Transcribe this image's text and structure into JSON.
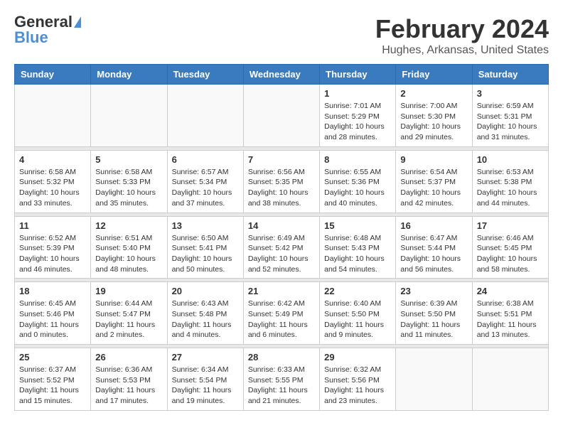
{
  "header": {
    "logo_general": "General",
    "logo_blue": "Blue",
    "month": "February 2024",
    "location": "Hughes, Arkansas, United States"
  },
  "weekdays": [
    "Sunday",
    "Monday",
    "Tuesday",
    "Wednesday",
    "Thursday",
    "Friday",
    "Saturday"
  ],
  "weeks": [
    [
      {
        "day": "",
        "info": ""
      },
      {
        "day": "",
        "info": ""
      },
      {
        "day": "",
        "info": ""
      },
      {
        "day": "",
        "info": ""
      },
      {
        "day": "1",
        "info": "Sunrise: 7:01 AM\nSunset: 5:29 PM\nDaylight: 10 hours\nand 28 minutes."
      },
      {
        "day": "2",
        "info": "Sunrise: 7:00 AM\nSunset: 5:30 PM\nDaylight: 10 hours\nand 29 minutes."
      },
      {
        "day": "3",
        "info": "Sunrise: 6:59 AM\nSunset: 5:31 PM\nDaylight: 10 hours\nand 31 minutes."
      }
    ],
    [
      {
        "day": "4",
        "info": "Sunrise: 6:58 AM\nSunset: 5:32 PM\nDaylight: 10 hours\nand 33 minutes."
      },
      {
        "day": "5",
        "info": "Sunrise: 6:58 AM\nSunset: 5:33 PM\nDaylight: 10 hours\nand 35 minutes."
      },
      {
        "day": "6",
        "info": "Sunrise: 6:57 AM\nSunset: 5:34 PM\nDaylight: 10 hours\nand 37 minutes."
      },
      {
        "day": "7",
        "info": "Sunrise: 6:56 AM\nSunset: 5:35 PM\nDaylight: 10 hours\nand 38 minutes."
      },
      {
        "day": "8",
        "info": "Sunrise: 6:55 AM\nSunset: 5:36 PM\nDaylight: 10 hours\nand 40 minutes."
      },
      {
        "day": "9",
        "info": "Sunrise: 6:54 AM\nSunset: 5:37 PM\nDaylight: 10 hours\nand 42 minutes."
      },
      {
        "day": "10",
        "info": "Sunrise: 6:53 AM\nSunset: 5:38 PM\nDaylight: 10 hours\nand 44 minutes."
      }
    ],
    [
      {
        "day": "11",
        "info": "Sunrise: 6:52 AM\nSunset: 5:39 PM\nDaylight: 10 hours\nand 46 minutes."
      },
      {
        "day": "12",
        "info": "Sunrise: 6:51 AM\nSunset: 5:40 PM\nDaylight: 10 hours\nand 48 minutes."
      },
      {
        "day": "13",
        "info": "Sunrise: 6:50 AM\nSunset: 5:41 PM\nDaylight: 10 hours\nand 50 minutes."
      },
      {
        "day": "14",
        "info": "Sunrise: 6:49 AM\nSunset: 5:42 PM\nDaylight: 10 hours\nand 52 minutes."
      },
      {
        "day": "15",
        "info": "Sunrise: 6:48 AM\nSunset: 5:43 PM\nDaylight: 10 hours\nand 54 minutes."
      },
      {
        "day": "16",
        "info": "Sunrise: 6:47 AM\nSunset: 5:44 PM\nDaylight: 10 hours\nand 56 minutes."
      },
      {
        "day": "17",
        "info": "Sunrise: 6:46 AM\nSunset: 5:45 PM\nDaylight: 10 hours\nand 58 minutes."
      }
    ],
    [
      {
        "day": "18",
        "info": "Sunrise: 6:45 AM\nSunset: 5:46 PM\nDaylight: 11 hours\nand 0 minutes."
      },
      {
        "day": "19",
        "info": "Sunrise: 6:44 AM\nSunset: 5:47 PM\nDaylight: 11 hours\nand 2 minutes."
      },
      {
        "day": "20",
        "info": "Sunrise: 6:43 AM\nSunset: 5:48 PM\nDaylight: 11 hours\nand 4 minutes."
      },
      {
        "day": "21",
        "info": "Sunrise: 6:42 AM\nSunset: 5:49 PM\nDaylight: 11 hours\nand 6 minutes."
      },
      {
        "day": "22",
        "info": "Sunrise: 6:40 AM\nSunset: 5:50 PM\nDaylight: 11 hours\nand 9 minutes."
      },
      {
        "day": "23",
        "info": "Sunrise: 6:39 AM\nSunset: 5:50 PM\nDaylight: 11 hours\nand 11 minutes."
      },
      {
        "day": "24",
        "info": "Sunrise: 6:38 AM\nSunset: 5:51 PM\nDaylight: 11 hours\nand 13 minutes."
      }
    ],
    [
      {
        "day": "25",
        "info": "Sunrise: 6:37 AM\nSunset: 5:52 PM\nDaylight: 11 hours\nand 15 minutes."
      },
      {
        "day": "26",
        "info": "Sunrise: 6:36 AM\nSunset: 5:53 PM\nDaylight: 11 hours\nand 17 minutes."
      },
      {
        "day": "27",
        "info": "Sunrise: 6:34 AM\nSunset: 5:54 PM\nDaylight: 11 hours\nand 19 minutes."
      },
      {
        "day": "28",
        "info": "Sunrise: 6:33 AM\nSunset: 5:55 PM\nDaylight: 11 hours\nand 21 minutes."
      },
      {
        "day": "29",
        "info": "Sunrise: 6:32 AM\nSunset: 5:56 PM\nDaylight: 11 hours\nand 23 minutes."
      },
      {
        "day": "",
        "info": ""
      },
      {
        "day": "",
        "info": ""
      }
    ]
  ]
}
